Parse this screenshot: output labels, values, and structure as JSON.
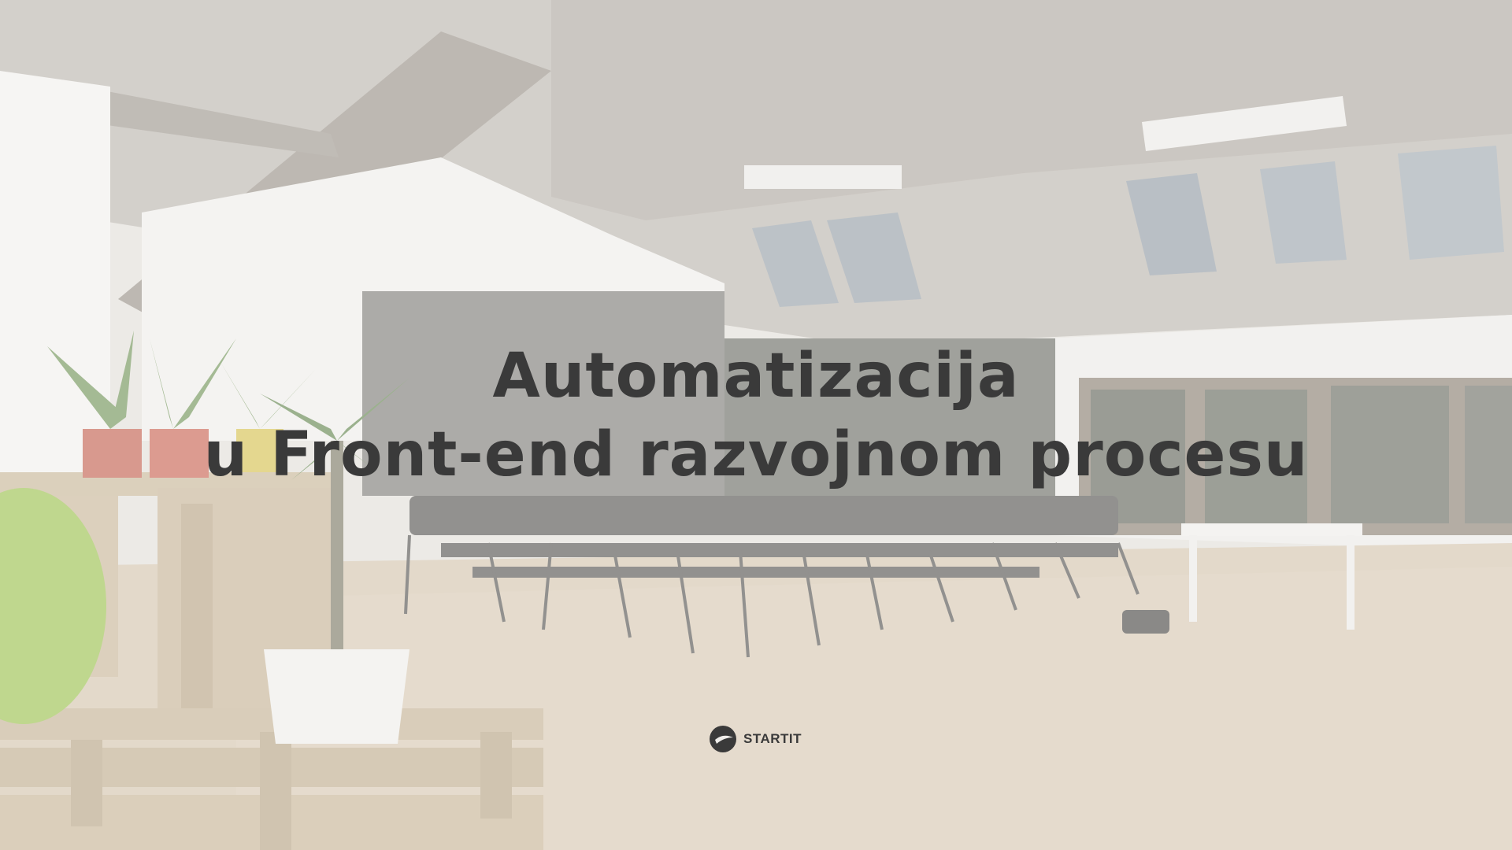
{
  "slide": {
    "title_line_1": "Automatizacija",
    "title_line_2": "u Front-end razvojnom procesu"
  },
  "logo": {
    "text": "STARTIT",
    "icon": "startit-logo-icon"
  },
  "background": {
    "description_icon": "office-loft-photo"
  },
  "colors": {
    "title": "#3a3a3a",
    "overlay": "#f0eeeb"
  }
}
